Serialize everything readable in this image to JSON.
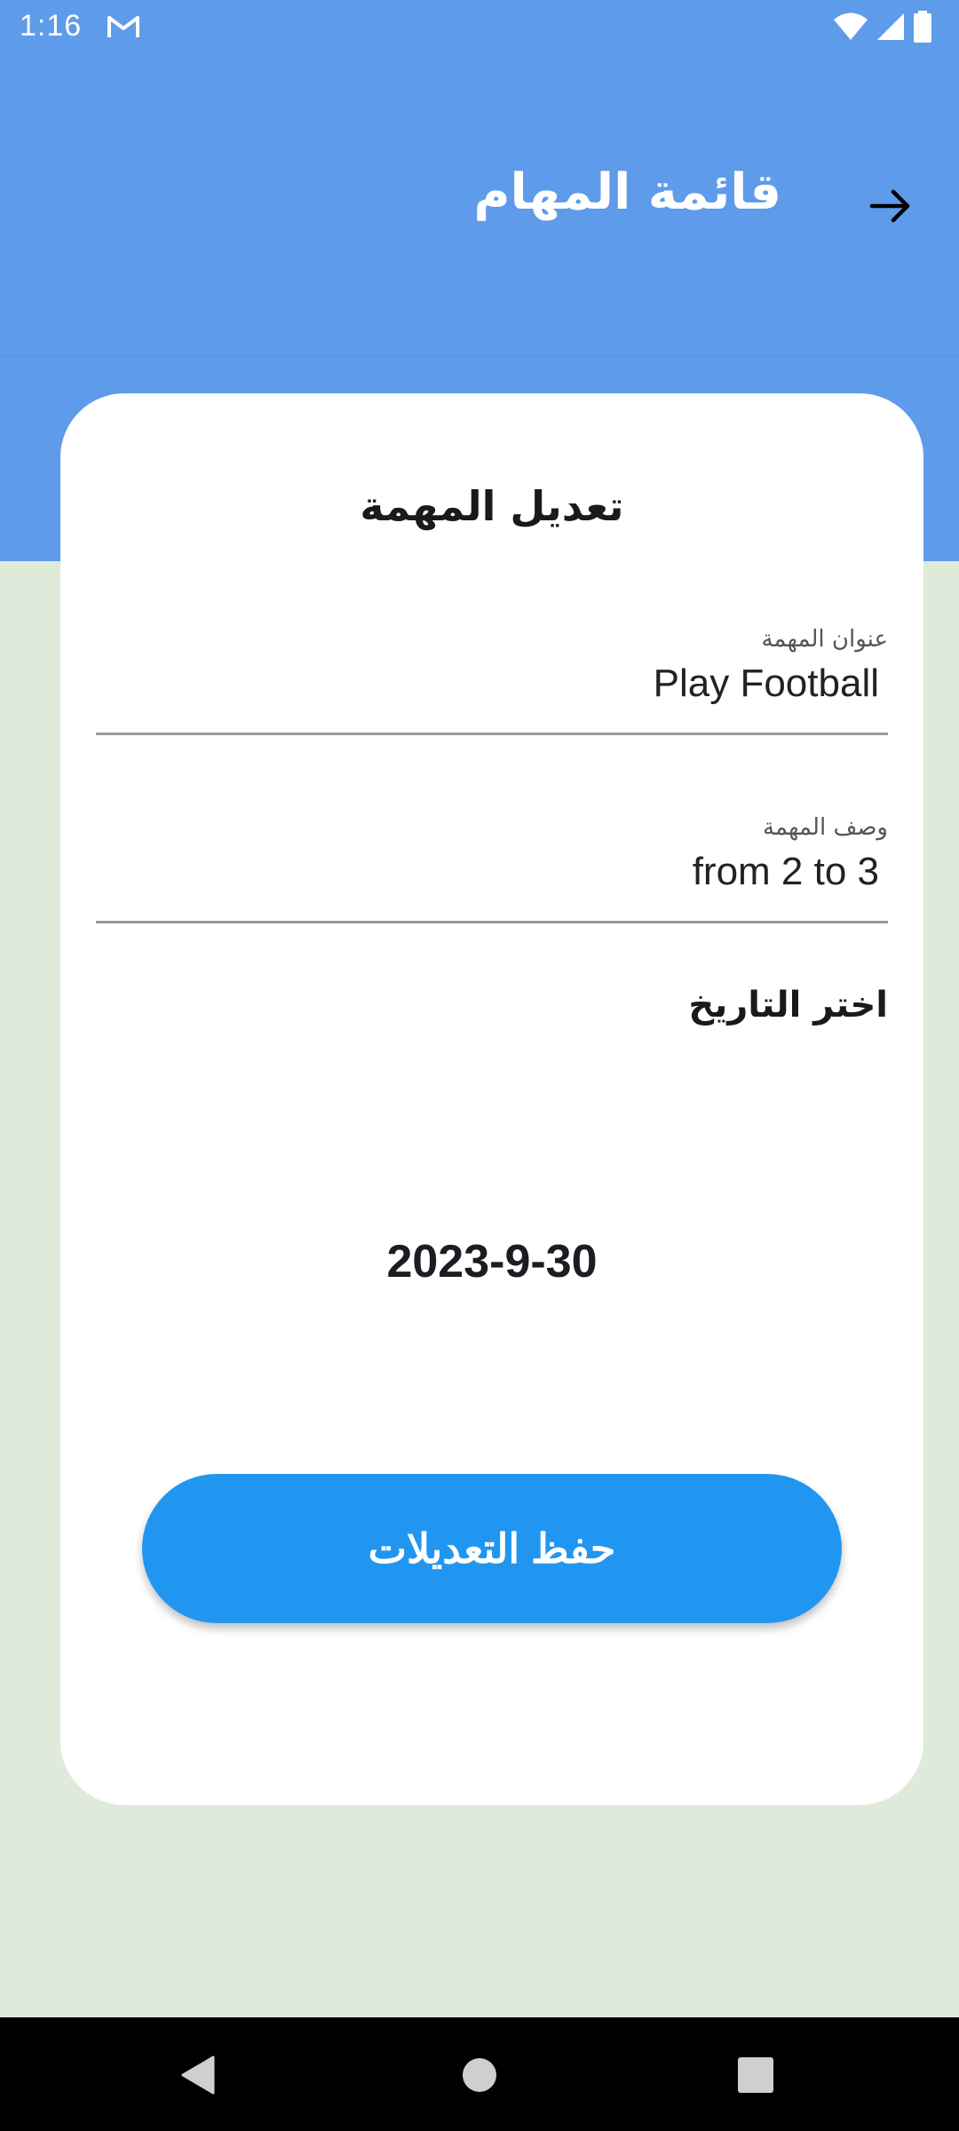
{
  "status_bar": {
    "time": "1:16",
    "notification_icon": "gmail-icon",
    "icons": [
      "wifi-icon",
      "signal-icon",
      "battery-icon"
    ]
  },
  "app_bar": {
    "title": "قائمة المهام",
    "back_icon": "arrow-right-icon"
  },
  "card": {
    "title": "تعديل المهمة",
    "fields": [
      {
        "label": "عنوان المهمة",
        "value": "Play Football"
      },
      {
        "label": "وصف المهمة",
        "value": "from 2 to 3"
      }
    ],
    "date_label": "اختر التاريخ",
    "date_value": "2023-9-30",
    "save_label": "حفظ التعديلات"
  },
  "nav_bar": {
    "icons": [
      "back-icon",
      "home-icon",
      "recents-icon"
    ]
  },
  "colors": {
    "app_bar": "#5e9bea",
    "background": "#dfeadb",
    "button": "#2196f0",
    "card": "#ffffff"
  }
}
